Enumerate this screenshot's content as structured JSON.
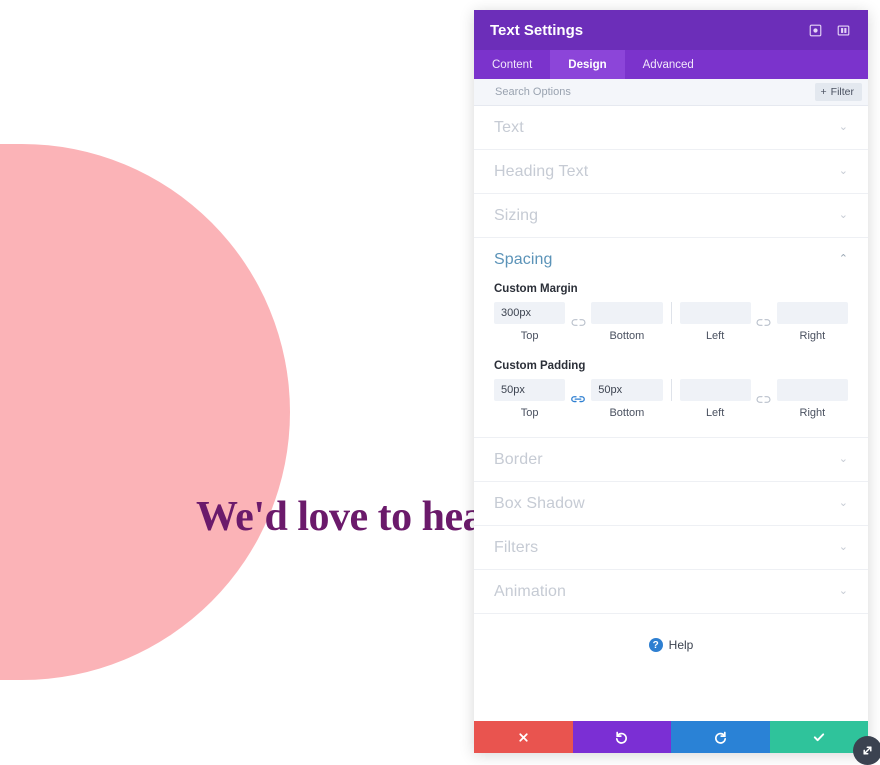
{
  "canvas": {
    "heading": "We'd love to hear from you.",
    "shape_color": "#fbb3b7",
    "heading_color": "#6b1a6b"
  },
  "panel": {
    "title": "Text Settings",
    "header_color": "#6c2eb9",
    "header_icons": [
      {
        "name": "focus-icon",
        "glyph": "⊙"
      },
      {
        "name": "layout-panel-icon",
        "glyph": "▣"
      }
    ],
    "tabs": [
      {
        "label": "Content",
        "active": false
      },
      {
        "label": "Design",
        "active": true
      },
      {
        "label": "Advanced",
        "active": false
      }
    ],
    "search": {
      "placeholder": "Search Options",
      "value": "",
      "filter_label": "Filter",
      "filter_icon": "+"
    },
    "sections": [
      {
        "label": "Text",
        "open": false,
        "chevron": "⌄"
      },
      {
        "label": "Heading Text",
        "open": false,
        "chevron": "⌄"
      },
      {
        "label": "Sizing",
        "open": false,
        "chevron": "⌄"
      },
      {
        "label": "Spacing",
        "open": true,
        "chevron": "⌃"
      },
      {
        "label": "Border",
        "open": false,
        "chevron": "⌄"
      },
      {
        "label": "Box Shadow",
        "open": false,
        "chevron": "⌄"
      },
      {
        "label": "Filters",
        "open": false,
        "chevron": "⌄"
      },
      {
        "label": "Animation",
        "open": false,
        "chevron": "⌄"
      }
    ],
    "spacing": {
      "margin": {
        "label": "Custom Margin",
        "top": {
          "value": "300px",
          "sub": "Top"
        },
        "bottom": {
          "value": "",
          "sub": "Bottom"
        },
        "left": {
          "value": "",
          "sub": "Left"
        },
        "right": {
          "value": "",
          "sub": "Right"
        },
        "link_top_bottom": "unlinked",
        "link_left_right": "unlinked"
      },
      "padding": {
        "label": "Custom Padding",
        "top": {
          "value": "50px",
          "sub": "Top"
        },
        "bottom": {
          "value": "50px",
          "sub": "Bottom"
        },
        "left": {
          "value": "",
          "sub": "Left"
        },
        "right": {
          "value": "",
          "sub": "Right"
        },
        "link_top_bottom": "linked",
        "link_left_right": "unlinked"
      }
    },
    "help": {
      "label": "Help",
      "badge": "?"
    },
    "footer": [
      {
        "name": "cancel-button",
        "glyph": "✕",
        "color": "#e9544f"
      },
      {
        "name": "undo-button",
        "glyph": "↺",
        "color": "#7b2fd4"
      },
      {
        "name": "redo-button",
        "glyph": "↻",
        "color": "#2a82d6"
      },
      {
        "name": "save-button",
        "glyph": "✓",
        "color": "#2fc39b"
      }
    ]
  },
  "drag_handle": {
    "name": "resize-handle",
    "glyph": "⤡"
  }
}
